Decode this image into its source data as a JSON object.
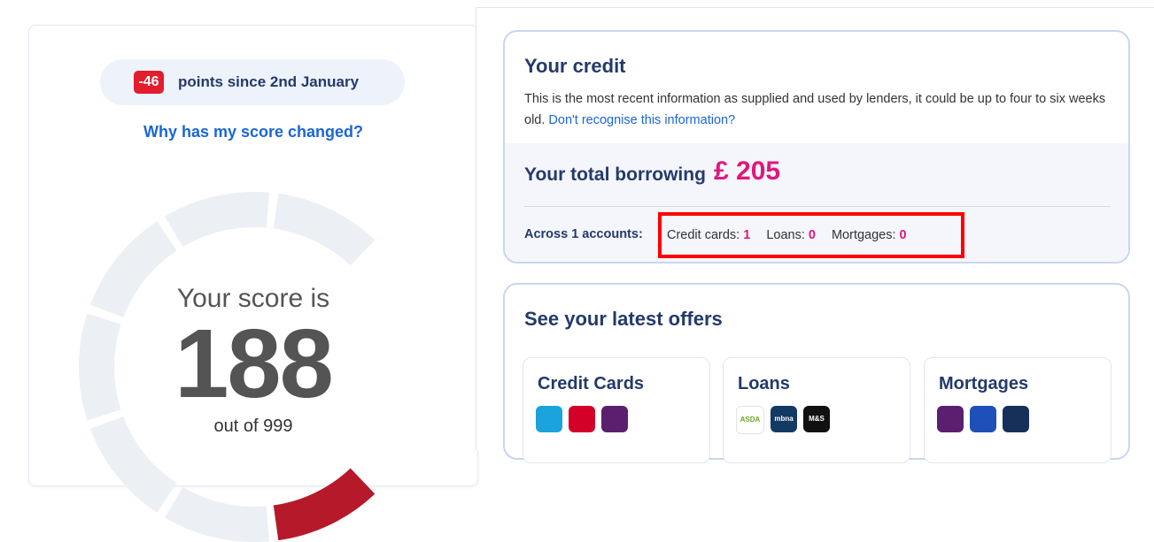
{
  "score_panel": {
    "change_badge": "-46",
    "change_text": "points since 2nd January",
    "why_link": "Why has my score changed?",
    "score_label": "Your score is",
    "score_value": "188",
    "score_max": "out of 999",
    "score_fraction": 0.188
  },
  "credit": {
    "title": "Your credit",
    "description": "This is the most recent information as supplied and used by lenders, it could be up to four to six weeks old.",
    "dont_recognise_link": "Don't recognise this information?",
    "total_borrowing_label": "Your total borrowing",
    "total_borrowing_amount": "£ 205",
    "accounts_label": "Across 1 accounts:",
    "counts": [
      {
        "label": "Credit cards:",
        "value": "1"
      },
      {
        "label": "Loans:",
        "value": "0"
      },
      {
        "label": "Mortgages:",
        "value": "0"
      }
    ]
  },
  "offers": {
    "title": "See your latest offers",
    "tiles": [
      {
        "title": "Credit Cards",
        "logos": [
          {
            "name": "barclays-logo-icon",
            "text": "",
            "color": "#1aa3dc"
          },
          {
            "name": "virgin-money-logo-icon",
            "text": "",
            "color": "#d4002a"
          },
          {
            "name": "natwest-logo-icon",
            "text": "",
            "color": "#5a1f6e"
          }
        ]
      },
      {
        "title": "Loans",
        "logos": [
          {
            "name": "asda-money-logo-icon",
            "text": "ASDA",
            "color": "#ffffff"
          },
          {
            "name": "mbna-logo-icon",
            "text": "mbna",
            "color": "#123a63"
          },
          {
            "name": "ms-bank-logo-icon",
            "text": "M&S",
            "color": "#111111"
          }
        ]
      },
      {
        "title": "Mortgages",
        "logos": [
          {
            "name": "natwest-logo-icon",
            "text": "",
            "color": "#5a1f6e"
          },
          {
            "name": "halifax-logo-icon",
            "text": "",
            "color": "#1f4fb8"
          },
          {
            "name": "santander-logo-icon",
            "text": "",
            "color": "#17305a"
          }
        ]
      }
    ]
  },
  "colors": {
    "accent_pink": "#e1167d",
    "navy": "#233a6b",
    "link_blue": "#1a66d6",
    "badge_red": "#e21d2e",
    "highlight_red": "#ff0000"
  }
}
